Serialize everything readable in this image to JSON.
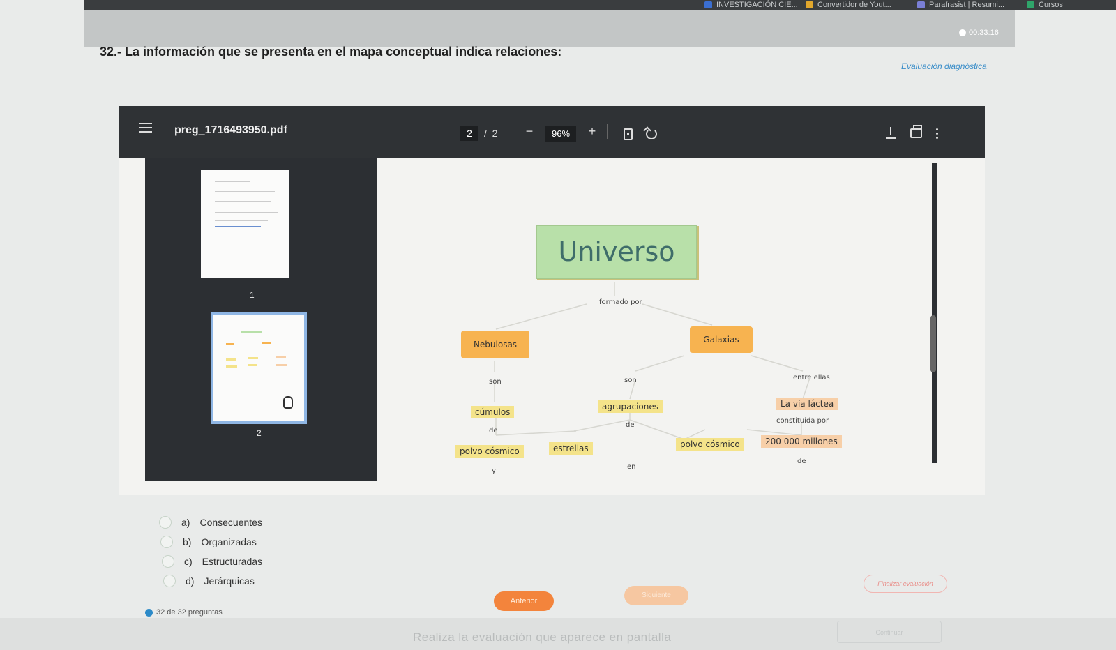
{
  "browser": {
    "bookmarks": [
      {
        "label": "INVESTIGACIÓN CIE...",
        "color": "#3b6fd1"
      },
      {
        "label": "Convertidor de Yout...",
        "color": "#e1a72c"
      },
      {
        "label": "Parafrasist | Resumi...",
        "color": "#7a7fd6"
      },
      {
        "label": "Cursos",
        "color": "#2fa56a"
      }
    ]
  },
  "timer": "00:33:16",
  "question": "32.- La información que se presenta en el mapa conceptual indica relaciones:",
  "eval_link": "Evaluación diagnóstica",
  "pdf": {
    "filename": "preg_1716493950.pdf",
    "current_page": "2",
    "page_sep": "/",
    "total_pages": "2",
    "zoom_out": "−",
    "zoom": "96%",
    "zoom_in": "+",
    "thumbnails": [
      "1",
      "2"
    ]
  },
  "concept_map": {
    "root": "Universo",
    "link_formado": "formado por",
    "nebulosas": "Nebulosas",
    "galaxias": "Galaxias",
    "son1": "son",
    "son2": "son",
    "entre": "entre ellas",
    "cumulos": "cúmulos",
    "agrupaciones": "agrupaciones",
    "via_lactea": "La vía láctea",
    "de1": "de",
    "de2": "de",
    "constituida": "constituida por",
    "polvo1": "polvo cósmico",
    "estrellas": "estrellas",
    "polvo2": "polvo cósmico",
    "millones": "200 000 millones",
    "y": "y",
    "en": "en",
    "de3": "de"
  },
  "options": [
    {
      "letter": "a)",
      "text": "Consecuentes"
    },
    {
      "letter": "b)",
      "text": "Organizadas"
    },
    {
      "letter": "c)",
      "text": "Estructuradas"
    },
    {
      "letter": "d)",
      "text": "Jerárquicas"
    }
  ],
  "question_count": "32 de 32 preguntas",
  "buttons": {
    "prev": "Anterior",
    "next": "Siguiente",
    "finish": "Finalizar evaluación",
    "continue": "Continuar"
  },
  "footer": "Realiza la evaluación que aparece en pantalla",
  "colors": {
    "toolbar": "#2f3235",
    "accent_orange": "#f3843c",
    "link_blue": "#3b8ec9"
  }
}
